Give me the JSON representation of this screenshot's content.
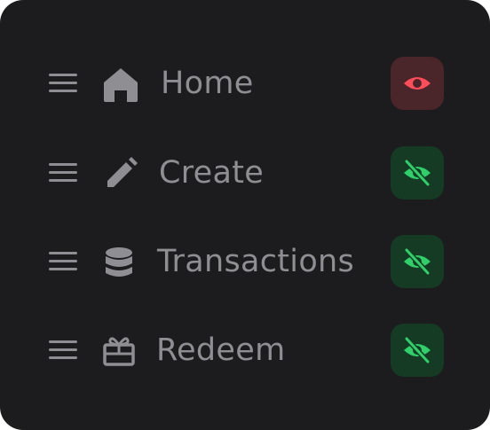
{
  "menu": {
    "items": [
      {
        "label": "Home",
        "icon": "home-icon",
        "visibility": "visible",
        "toggle_icon": "eye-icon"
      },
      {
        "label": "Create",
        "icon": "pencil-icon",
        "visibility": "hidden",
        "toggle_icon": "eye-off-icon"
      },
      {
        "label": "Transactions",
        "icon": "database-icon",
        "visibility": "hidden",
        "toggle_icon": "eye-off-icon"
      },
      {
        "label": "Redeem",
        "icon": "gift-icon",
        "visibility": "hidden",
        "toggle_icon": "eye-off-icon"
      }
    ]
  },
  "colors": {
    "panel_background": "#1c1c1e",
    "text": "#8e8e93",
    "visible_toggle_bg": "#4a2529",
    "visible_icon": "#ff4d5a",
    "hidden_toggle_bg": "#163b25",
    "hidden_icon": "#2fd06a"
  }
}
